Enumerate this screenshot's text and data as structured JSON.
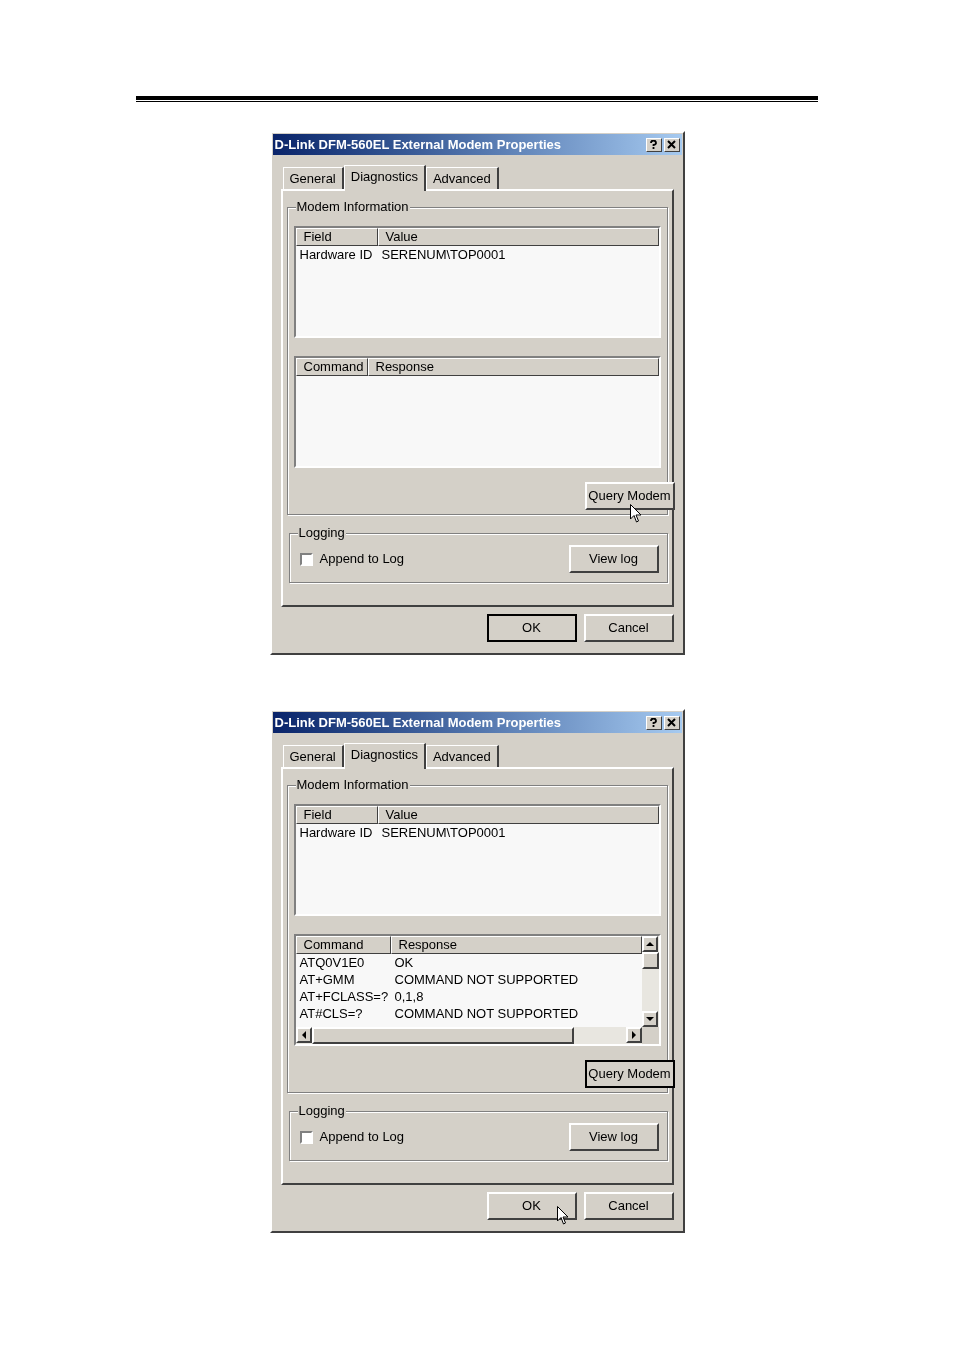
{
  "dialogs": [
    {
      "title": "D-Link DFM-560EL External Modem Properties",
      "tabs": [
        {
          "label": "General",
          "selected": false
        },
        {
          "label": "Diagnostics",
          "selected": true
        },
        {
          "label": "Advanced",
          "selected": false
        }
      ],
      "modem_group": "Modem Information",
      "info_table": {
        "columns": [
          "Field",
          "Value"
        ],
        "rows": [
          [
            "Hardware ID",
            "SERENUM\\TOP0001"
          ]
        ]
      },
      "command_table": {
        "columns": [
          "Command",
          "Response"
        ]
      },
      "query_button": {
        "label": "Query Modem",
        "pointer_over": true
      },
      "logging_group": "Logging",
      "append_to_log": {
        "label": "Append to Log",
        "checked": false
      },
      "view_log_button": "View log",
      "ok_button": {
        "label": "OK",
        "pointer_over": false
      },
      "cancel_button": "Cancel"
    },
    {
      "title": "D-Link DFM-560EL External Modem Properties",
      "tabs": [
        {
          "label": "General",
          "selected": false
        },
        {
          "label": "Diagnostics",
          "selected": true
        },
        {
          "label": "Advanced",
          "selected": false
        }
      ],
      "modem_group": "Modem Information",
      "info_table": {
        "columns": [
          "Field",
          "Value"
        ],
        "rows": [
          [
            "Hardware ID",
            "SERENUM\\TOP0001"
          ]
        ]
      },
      "command_table": {
        "columns": [
          "Command",
          "Response"
        ],
        "rows": [
          [
            "ATQ0V1E0",
            "OK"
          ],
          [
            "AT+GMM",
            "COMMAND NOT SUPPORTED"
          ],
          [
            "AT+FCLASS=?",
            "0,1,8"
          ],
          [
            "AT#CLS=?",
            "COMMAND NOT SUPPORTED"
          ]
        ]
      },
      "query_button": {
        "label": "Query Modem",
        "pointer_over": false
      },
      "logging_group": "Logging",
      "append_to_log": {
        "label": "Append to Log",
        "checked": false
      },
      "view_log_button": "View log",
      "ok_button": {
        "label": "OK",
        "pointer_over": true
      },
      "cancel_button": "Cancel"
    }
  ]
}
